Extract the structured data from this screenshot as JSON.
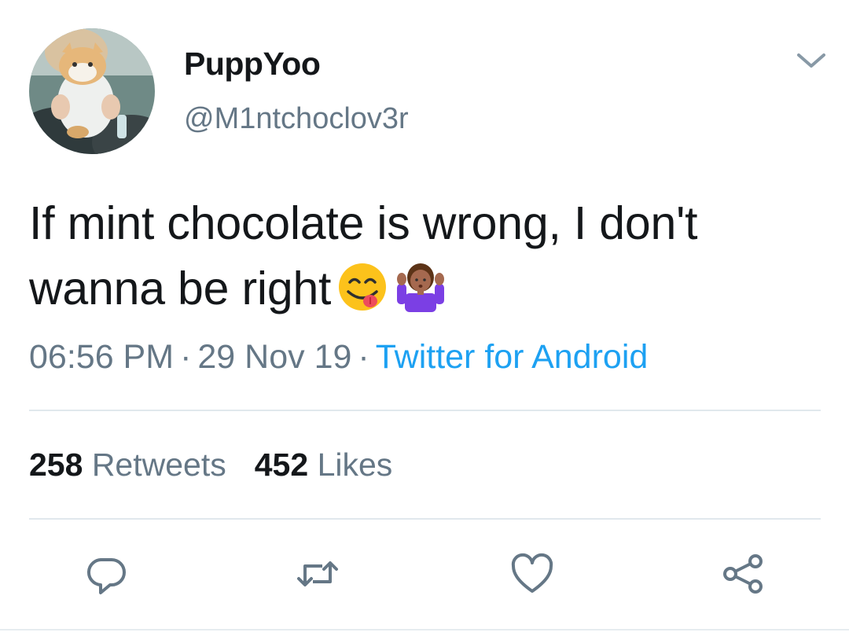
{
  "user": {
    "display_name": "PuppYoo",
    "handle": "@M1ntchoclov3r"
  },
  "tweet": {
    "text": "If mint chocolate is wrong, I don't wanna be right",
    "emojis": [
      "face-savoring-food-emoji",
      "person-shrugging-emoji"
    ]
  },
  "meta": {
    "time": "06:56 PM",
    "separator": "·",
    "date": "29 Nov 19",
    "source": "Twitter for Android"
  },
  "stats": {
    "retweets_count": "258",
    "retweets_label": "Retweets",
    "likes_count": "452",
    "likes_label": "Likes"
  },
  "icons": {
    "menu": "chevron-down-icon",
    "reply": "reply-icon",
    "retweet": "retweet-icon",
    "like": "heart-icon",
    "share": "share-icon"
  },
  "colors": {
    "text": "#14171a",
    "secondary": "#657786",
    "link": "#1da1f2",
    "divider": "#e1e8ed"
  }
}
